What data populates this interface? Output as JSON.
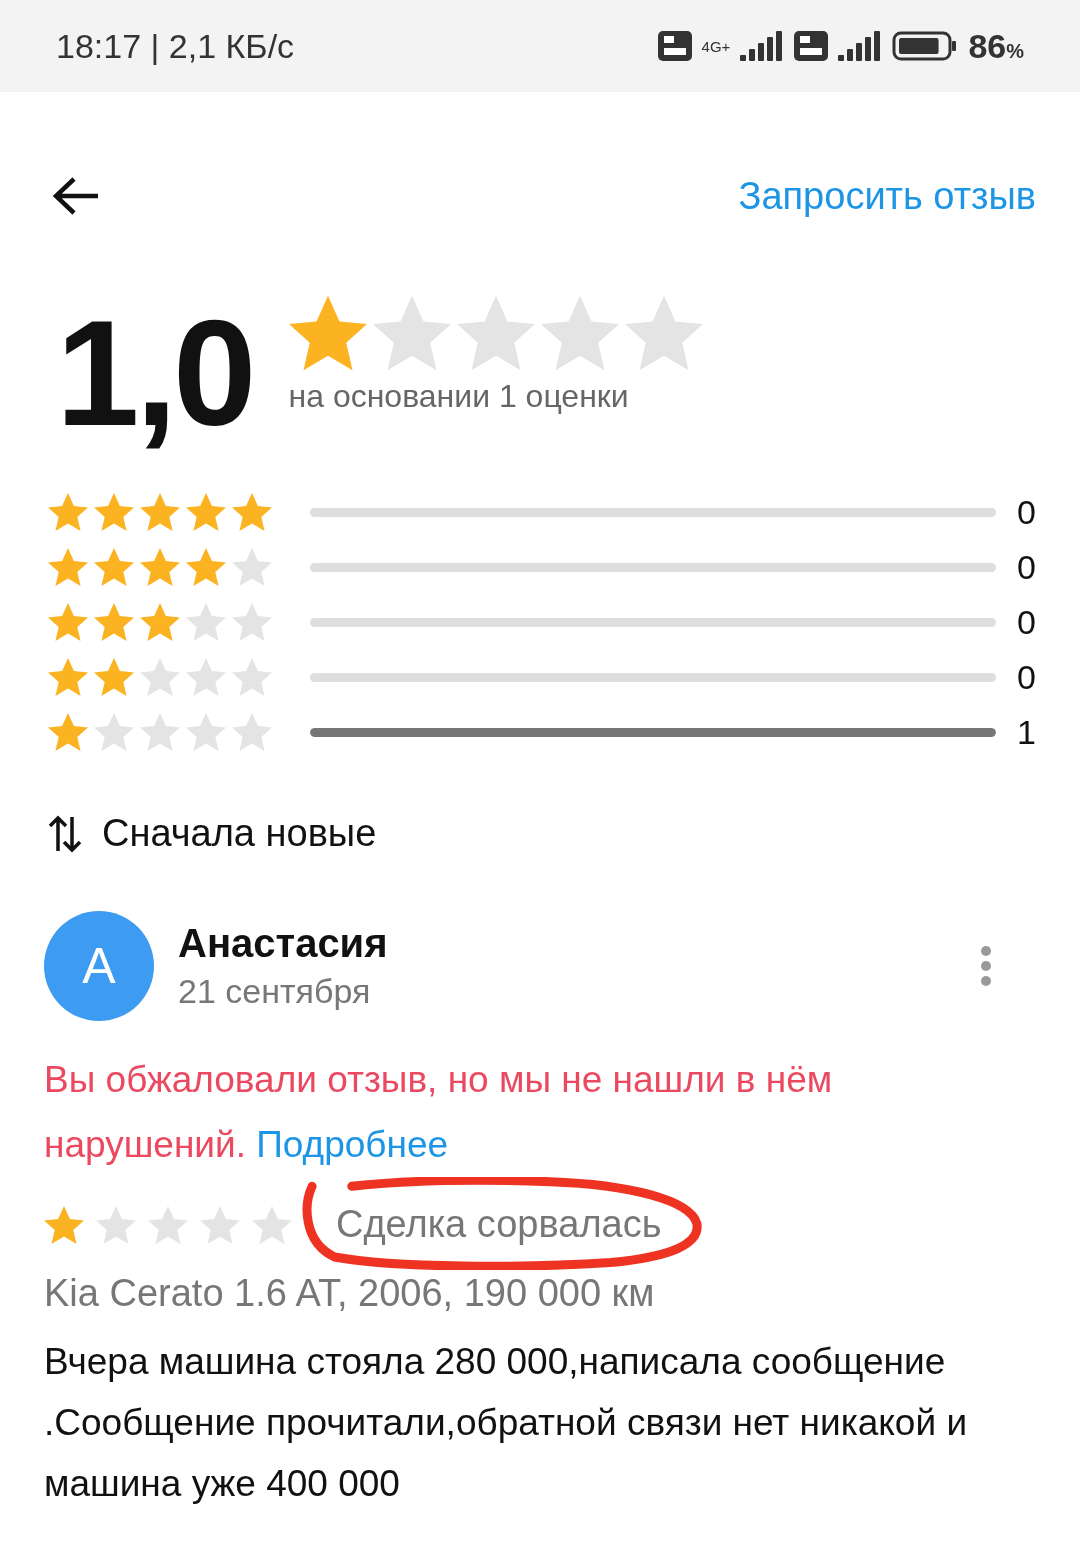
{
  "status_bar": {
    "time": "18:17 | 2,1 КБ/с",
    "network": "4G+",
    "battery": "86",
    "battery_unit": "%"
  },
  "header": {
    "action": "Запросить отзыв"
  },
  "rating": {
    "score": "1,0",
    "stars": 1,
    "caption": "на основании 1 оценки"
  },
  "histogram": [
    {
      "stars": 5,
      "level": 0,
      "count": "0"
    },
    {
      "stars": 4,
      "level": 0,
      "count": "0"
    },
    {
      "stars": 3,
      "level": 0,
      "count": "0"
    },
    {
      "stars": 2,
      "level": 0,
      "count": "0"
    },
    {
      "stars": 1,
      "level": 1,
      "count": "1"
    }
  ],
  "sort": {
    "label": "Сначала новые"
  },
  "review": {
    "avatar": "А",
    "author": "Анастасия",
    "date": "21 сентября",
    "notice": "Вы обжаловали отзыв, но мы не нашли в нём нарушений.",
    "notice_link": "Подробнее",
    "stars": 1,
    "outcome": "Сделка сорвалась",
    "car": "Kia Cerato 1.6 AT, 2006, 190 000 км",
    "text": "Вчера машина стояла 280 000,написала сообщение .Сообщение прочитали,обратной связи нет никакой и машина уже 400 000"
  }
}
